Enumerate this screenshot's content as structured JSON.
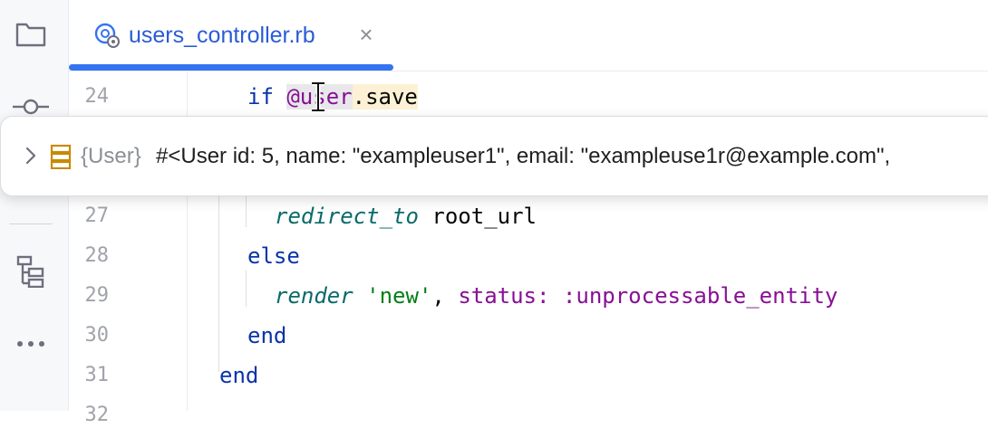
{
  "tab": {
    "filename": "users_controller.rb",
    "close_glyph": "×",
    "active": true
  },
  "sidebar": {
    "items": [
      {
        "name": "project",
        "icon": "folder-icon"
      },
      {
        "name": "commit",
        "icon": "commit-icon"
      },
      {
        "name": "structure",
        "icon": "structure-icon"
      },
      {
        "name": "more",
        "icon": "more-icon",
        "glyph": "•••"
      }
    ]
  },
  "gutter": {
    "line_numbers": [
      "24",
      "27",
      "28",
      "29",
      "30",
      "31",
      "32"
    ]
  },
  "code": {
    "line24": {
      "kw": "if",
      "ivar_a": "@u",
      "ivar_b": "ser",
      "rest": ".save"
    },
    "line27": {
      "meth": "redirect_to",
      "rest": " root_url"
    },
    "line28": {
      "kw": "else"
    },
    "line29": {
      "meth": "render",
      "str": "'new'",
      "comma": ",",
      "key": "status:",
      "sym": ":unprocessable_entity"
    },
    "line30": {
      "kw": "end"
    },
    "line31": {
      "kw": "end"
    }
  },
  "popup": {
    "type_label": "{User}",
    "value": "#<User id: 5, name: \"exampleuser1\", email: \"exampleuse1r@example.com\","
  },
  "colors": {
    "accent": "#3574f0",
    "keyword": "#0a33a9",
    "instance_var": "#871094",
    "method": "#0a6a6a",
    "string": "#067d17",
    "line_number": "#a0a3aa"
  }
}
